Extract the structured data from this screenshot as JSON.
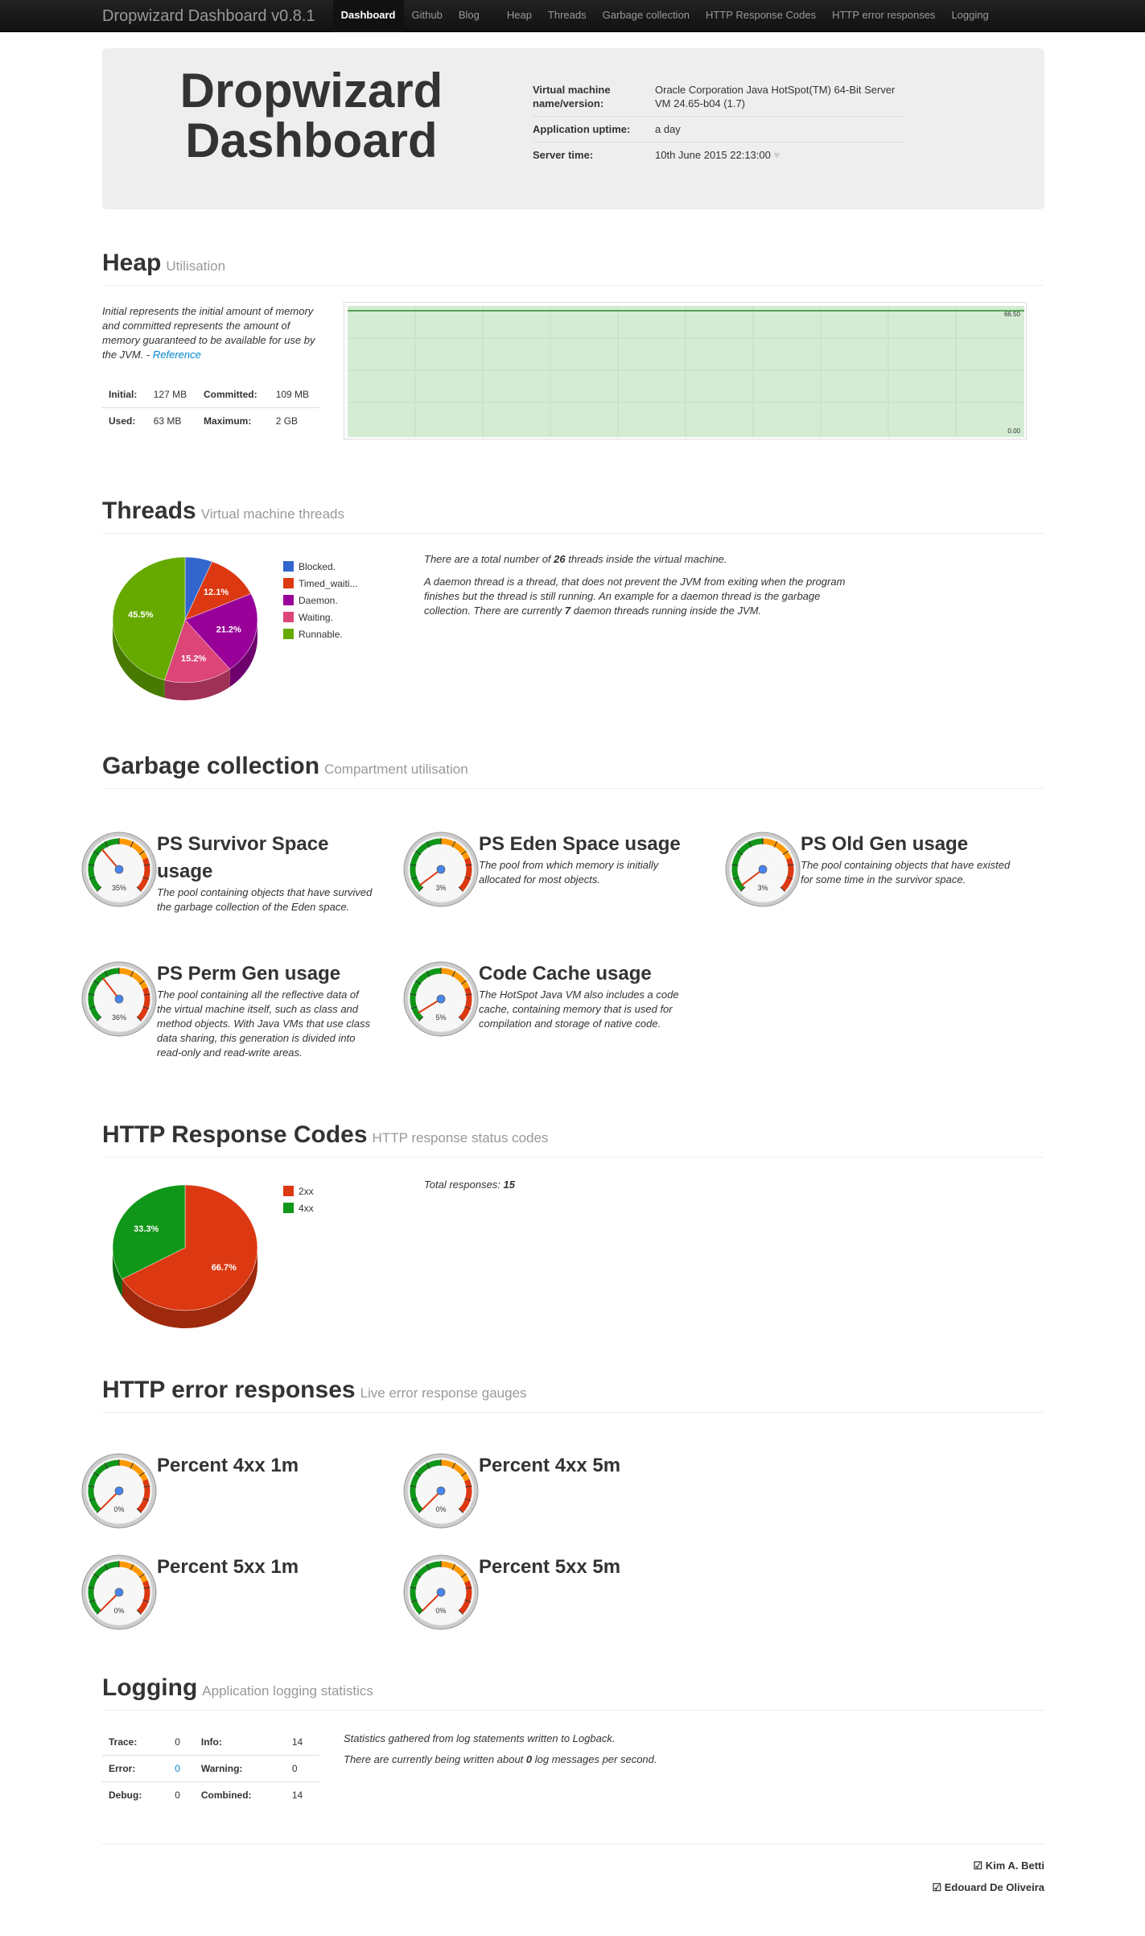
{
  "nav": {
    "brand": "Dropwizard Dashboard v0.8.1",
    "items": [
      "Dashboard",
      "Github",
      "Blog",
      "Heap",
      "Threads",
      "Garbage collection",
      "HTTP Response Codes",
      "HTTP error responses",
      "Logging"
    ]
  },
  "hero": {
    "title_line1": "Dropwizard",
    "title_line2": "Dashboard",
    "rows": [
      {
        "key": "Virtual machine name/version:",
        "value": "Oracle Corporation Java HotSpot(TM) 64-Bit Server VM 24.65-b04 (1.7)"
      },
      {
        "key": "Application uptime:",
        "value": "a day"
      },
      {
        "key": "Server time:",
        "value": "10th June 2015 22:13:00"
      }
    ]
  },
  "heap": {
    "title": "Heap",
    "subtitle": "Utilisation",
    "desc": "Initial represents the initial amount of memory and committed represents the amount of memory guaranteed to be available for use by the JVM. -",
    "ref": "Reference",
    "initial_k": "Initial:",
    "initial_v": "127 MB",
    "committed_k": "Committed:",
    "committed_v": "109 MB",
    "used_k": "Used:",
    "used_v": "63 MB",
    "max_k": "Maximum:",
    "max_v": "2 GB",
    "chart_top": "66.50",
    "chart_bottom": "0.00"
  },
  "threads": {
    "title": "Threads",
    "subtitle": "Virtual machine threads",
    "p1a": "There are a total number of ",
    "p1n": "26",
    "p1b": " threads inside the virtual machine.",
    "p2a": "A daemon thread is a thread, that does not prevent the JVM from exiting when the program finishes but the thread is still running. An example for a daemon thread is the garbage collection. There are currently ",
    "p2n": "7",
    "p2b": " daemon threads running inside the JVM."
  },
  "gc": {
    "title": "Garbage collection",
    "subtitle": "Compartment utilisation",
    "gauges": [
      {
        "title": "PS Survivor Space usage",
        "desc": "The pool containing objects that have survived the garbage collection of the Eden space.",
        "pct": 35,
        "label": "35%"
      },
      {
        "title": "PS Eden Space usage",
        "desc": "The pool from which memory is initially allocated for most objects.",
        "pct": 3,
        "label": "3%"
      },
      {
        "title": "PS Old Gen usage",
        "desc": "The pool containing objects that have existed for some time in the survivor space.",
        "pct": 3,
        "label": "3%"
      },
      {
        "title": "PS Perm Gen usage",
        "desc": "The pool containing all the reflective data of the virtual machine itself, such as class and method objects. With Java VMs that use class data sharing, this generation is divided into read-only and read-write areas.",
        "pct": 36,
        "label": "36%"
      },
      {
        "title": "Code Cache usage",
        "desc": "The HotSpot Java VM also includes a code cache, containing memory that is used for compilation and storage of native code.",
        "pct": 5,
        "label": "5%"
      }
    ]
  },
  "http": {
    "title": "HTTP Response Codes",
    "subtitle": "HTTP response status codes",
    "total_label": "Total responses: ",
    "total": "15"
  },
  "errors": {
    "title": "HTTP error responses",
    "subtitle": "Live error response gauges",
    "gauges": [
      {
        "title": "Percent 4xx 1m",
        "pct": 0,
        "label": "0%"
      },
      {
        "title": "Percent 4xx 5m",
        "pct": 0,
        "label": "0%"
      },
      {
        "title": "Percent 5xx 1m",
        "pct": 0,
        "label": "0%"
      },
      {
        "title": "Percent 5xx 5m",
        "pct": 0,
        "label": "0%"
      }
    ]
  },
  "logging": {
    "title": "Logging",
    "subtitle": "Application logging statistics",
    "trace_k": "Trace:",
    "trace_v": "0",
    "info_k": "Info:",
    "info_v": "14",
    "error_k": "Error:",
    "error_v": "0",
    "warn_k": "Warning:",
    "warn_v": "0",
    "debug_k": "Debug:",
    "debug_v": "0",
    "comb_k": "Combined:",
    "comb_v": "14",
    "p1": "Statistics gathered from log statements written to Logback.",
    "p2a": "There are currently being written about ",
    "p2n": "0",
    "p2b": " log messages per second."
  },
  "footer": {
    "author1": "Kim A. Betti",
    "author2": "Edouard De Oliveira"
  },
  "chart_data": [
    {
      "type": "pie",
      "title": "",
      "categories": [
        "Blocked.",
        "Timed_waiti...",
        "Daemon.",
        "Waiting.",
        "Runnable."
      ],
      "values": [
        6.1,
        12.1,
        21.2,
        15.2,
        45.5
      ],
      "labels": [
        "",
        "12.1%",
        "21.2%",
        "15.2%",
        "45.5%"
      ],
      "colors": [
        "#3366cc",
        "#dc3912",
        "#990099",
        "#dd4477",
        "#66aa00"
      ],
      "legend": "right"
    },
    {
      "type": "pie",
      "title": "",
      "categories": [
        "2xx",
        "4xx"
      ],
      "values": [
        66.7,
        33.3
      ],
      "labels": [
        "66.7%",
        "33.3%"
      ],
      "colors": [
        "#dc3912",
        "#109618"
      ],
      "legend": "right"
    }
  ]
}
